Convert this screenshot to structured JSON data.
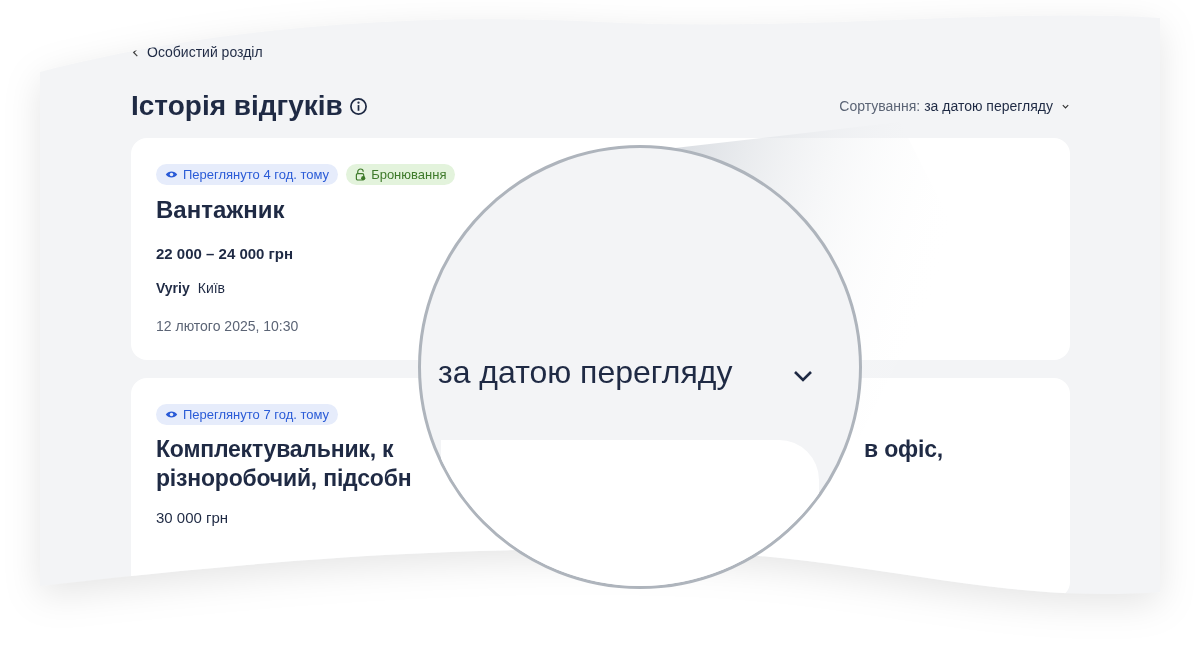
{
  "back_link": {
    "label": "Особистий розділ"
  },
  "title": "Історія відгуків",
  "sort": {
    "label": "Сортування:",
    "value": "за датою перегляду"
  },
  "responses": [
    {
      "tags": [
        {
          "kind": "viewed",
          "label": "Переглянуто 4 год. тому"
        },
        {
          "kind": "booking",
          "label": "Бронювання"
        }
      ],
      "title_parts": [
        "Вантажник"
      ],
      "salary": "22 000 – 24 000 грн",
      "company": "Vyriy",
      "city": "Київ",
      "date": "12 лютого 2025, 10:30"
    },
    {
      "tags": [
        {
          "kind": "viewed",
          "label": "Переглянуто 7 год. тому"
        }
      ],
      "title_parts": [
        "Комплектувальник, к",
        "в офіс,",
        "різноробочий, підсобн"
      ],
      "salary": "30 000 грн"
    }
  ],
  "magnifier": {
    "sort_value": "за датою перегляду"
  }
}
